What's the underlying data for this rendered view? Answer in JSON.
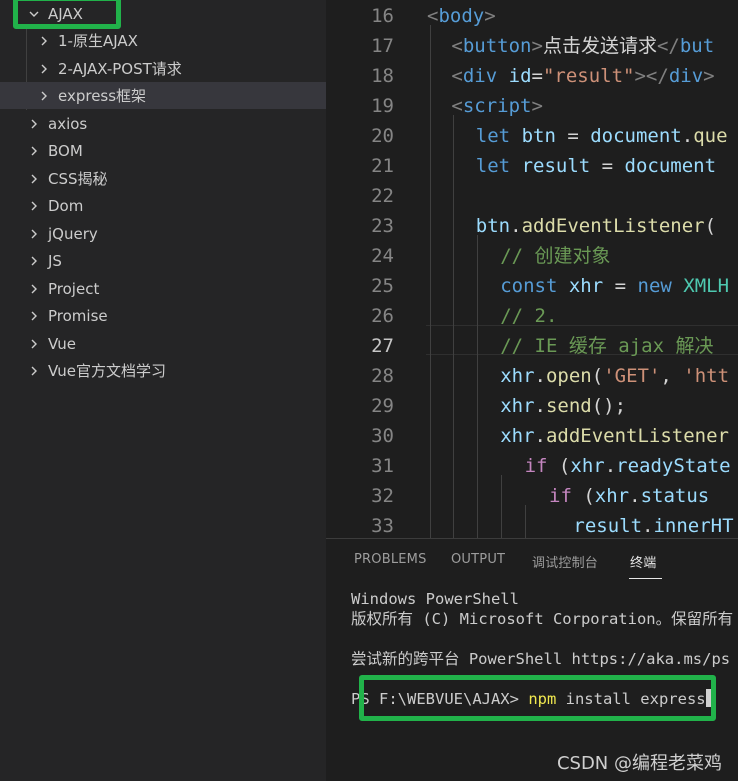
{
  "explorer": {
    "items": [
      {
        "label": "AJAX",
        "expanded": true
      },
      {
        "label": "1-原生AJAX"
      },
      {
        "label": "2-AJAX-POST请求"
      },
      {
        "label": "express框架"
      },
      {
        "label": "axios"
      },
      {
        "label": "BOM"
      },
      {
        "label": "CSS揭秘"
      },
      {
        "label": "Dom"
      },
      {
        "label": "jQuery"
      },
      {
        "label": "JS"
      },
      {
        "label": "Project"
      },
      {
        "label": "Promise"
      },
      {
        "label": "Vue"
      },
      {
        "label": "Vue官方文档学习"
      }
    ]
  },
  "editor": {
    "active_line": "27",
    "lines": [
      {
        "num": "16",
        "tokens": [
          [
            "t-punc",
            "<"
          ],
          [
            "t-tag",
            "body"
          ],
          [
            "t-punc",
            ">"
          ]
        ]
      },
      {
        "num": "17",
        "tokens": [
          [
            "t-punc",
            "<"
          ],
          [
            "t-tag",
            "button"
          ],
          [
            "t-punc",
            ">"
          ],
          [
            "t-plain",
            "点击发送请求"
          ],
          [
            "t-punc",
            "</"
          ],
          [
            "t-tag",
            "but"
          ]
        ]
      },
      {
        "num": "18",
        "tokens": [
          [
            "t-punc",
            "<"
          ],
          [
            "t-tag",
            "div"
          ],
          [
            "t-plain",
            " "
          ],
          [
            "t-attr",
            "id"
          ],
          [
            "t-plain",
            "="
          ],
          [
            "t-str",
            "\"result\""
          ],
          [
            "t-punc",
            "></"
          ],
          [
            "t-tag",
            "div"
          ],
          [
            "t-punc",
            ">"
          ]
        ]
      },
      {
        "num": "19",
        "tokens": [
          [
            "t-punc",
            "<"
          ],
          [
            "t-tag",
            "script"
          ],
          [
            "t-punc",
            ">"
          ]
        ]
      },
      {
        "num": "20",
        "tokens": [
          [
            "t-kw",
            "let"
          ],
          [
            "t-plain",
            " "
          ],
          [
            "t-var",
            "btn"
          ],
          [
            "t-plain",
            " = "
          ],
          [
            "t-var",
            "document"
          ],
          [
            "t-plain",
            "."
          ],
          [
            "t-fn",
            "que"
          ]
        ]
      },
      {
        "num": "21",
        "tokens": [
          [
            "t-kw",
            "let"
          ],
          [
            "t-plain",
            " "
          ],
          [
            "t-var",
            "result"
          ],
          [
            "t-plain",
            " = "
          ],
          [
            "t-var",
            "document"
          ]
        ]
      },
      {
        "num": "22",
        "tokens": []
      },
      {
        "num": "23",
        "tokens": [
          [
            "t-var",
            "btn"
          ],
          [
            "t-plain",
            "."
          ],
          [
            "t-fn",
            "addEventListener"
          ],
          [
            "t-plain",
            "("
          ]
        ]
      },
      {
        "num": "24",
        "tokens": [
          [
            "t-cmt",
            "// 创建对象"
          ]
        ]
      },
      {
        "num": "25",
        "tokens": [
          [
            "t-kw",
            "const"
          ],
          [
            "t-plain",
            " "
          ],
          [
            "t-var",
            "xhr"
          ],
          [
            "t-plain",
            " = "
          ],
          [
            "t-kw",
            "new"
          ],
          [
            "t-plain",
            " "
          ],
          [
            "t-cls",
            "XMLH"
          ]
        ]
      },
      {
        "num": "26",
        "tokens": [
          [
            "t-cmt",
            "// 2."
          ]
        ]
      },
      {
        "num": "27",
        "tokens": [
          [
            "t-cmt",
            "// IE 缓存 ajax 解决"
          ]
        ]
      },
      {
        "num": "28",
        "tokens": [
          [
            "t-var",
            "xhr"
          ],
          [
            "t-plain",
            "."
          ],
          [
            "t-fn",
            "open"
          ],
          [
            "t-plain",
            "("
          ],
          [
            "t-str",
            "'GET'"
          ],
          [
            "t-plain",
            ", "
          ],
          [
            "t-str",
            "'htt"
          ]
        ]
      },
      {
        "num": "29",
        "tokens": [
          [
            "t-var",
            "xhr"
          ],
          [
            "t-plain",
            "."
          ],
          [
            "t-fn",
            "send"
          ],
          [
            "t-plain",
            "();"
          ]
        ]
      },
      {
        "num": "30",
        "tokens": [
          [
            "t-var",
            "xhr"
          ],
          [
            "t-plain",
            "."
          ],
          [
            "t-fn",
            "addEventListener"
          ]
        ]
      },
      {
        "num": "31",
        "tokens": [
          [
            "t-ctrl",
            "if"
          ],
          [
            "t-plain",
            " ("
          ],
          [
            "t-var",
            "xhr"
          ],
          [
            "t-plain",
            "."
          ],
          [
            "t-var",
            "readyState"
          ]
        ]
      },
      {
        "num": "32",
        "tokens": [
          [
            "t-ctrl",
            "if"
          ],
          [
            "t-plain",
            " ("
          ],
          [
            "t-var",
            "xhr"
          ],
          [
            "t-plain",
            "."
          ],
          [
            "t-var",
            "status"
          ]
        ]
      },
      {
        "num": "33",
        "tokens": [
          [
            "t-var",
            "result"
          ],
          [
            "t-plain",
            "."
          ],
          [
            "t-var",
            "innerHT"
          ]
        ]
      }
    ]
  },
  "panel": {
    "tabs": [
      "PROBLEMS",
      "OUTPUT",
      "调试控制台",
      "终端"
    ],
    "active_tab": "终端",
    "terminal": {
      "line1": "Windows PowerShell",
      "line2": "版权所有 (C) Microsoft Corporation。保留所有",
      "line3": "尝试新的跨平台 PowerShell https://aka.ms/ps",
      "prompt": "PS F:\\WEBVUE\\AJAX> ",
      "command": "npm",
      "args": " install express"
    }
  },
  "watermark": "CSDN @编程老菜鸡",
  "colors": {
    "highlight_box": "#21b24a"
  }
}
